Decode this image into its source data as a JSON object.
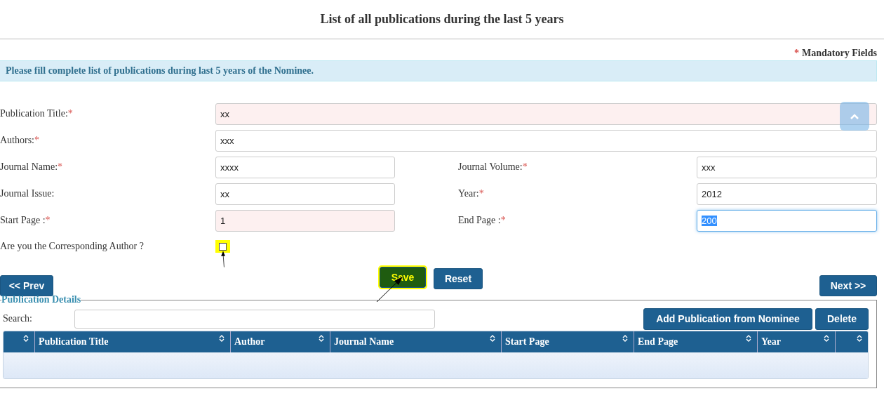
{
  "page_title": "List of all publications during the last 5 years",
  "mandatory_note": {
    "mark": "*",
    "text": "Mandatory Fields"
  },
  "info_message": "Please fill complete list of publications during last 5 years of the Nominee.",
  "form_rows": [
    {
      "kind": "full",
      "fields": [
        {
          "label": "Publication Title:",
          "mark": "*",
          "value": "xx",
          "invalid": true,
          "focused": false,
          "selected_text": false
        }
      ]
    },
    {
      "kind": "full",
      "fields": [
        {
          "label": "Authors:",
          "mark": "*",
          "value": "xxx",
          "invalid": false,
          "focused": false,
          "selected_text": false
        }
      ]
    },
    {
      "kind": "pair",
      "fields": [
        {
          "label": "Journal Name:",
          "mark": "*",
          "value": "xxxx",
          "invalid": false,
          "focused": false,
          "selected_text": false
        },
        {
          "label": "Journal Volume:",
          "mark": "*",
          "value": "xxx",
          "invalid": false,
          "focused": false,
          "selected_text": false
        }
      ]
    },
    {
      "kind": "pair",
      "fields": [
        {
          "label": "Journal Issue:",
          "value": "xx",
          "invalid": false,
          "focused": false,
          "selected_text": false
        },
        {
          "label": "Year:",
          "mark": "*",
          "value": "2012",
          "invalid": false,
          "focused": false,
          "selected_text": false
        }
      ]
    },
    {
      "kind": "pair",
      "fields": [
        {
          "label": "Start Page :",
          "mark": "*",
          "value": "1",
          "invalid": true,
          "focused": false,
          "selected_text": false
        },
        {
          "label": "End Page :",
          "mark": "*",
          "value": "200",
          "invalid": false,
          "focused": true,
          "selected_text": true
        }
      ]
    }
  ],
  "corresponding_author": {
    "label": "Are you the Corresponding Author ?",
    "checked": false,
    "highlighted": true
  },
  "buttons": {
    "prev": "<< Prev",
    "save": {
      "label": "Save",
      "highlighted": true
    },
    "reset": "Reset",
    "next": "Next >>"
  },
  "publication_details": {
    "legend": "Publication Details",
    "search_label": "Search:",
    "actions": [
      "Add Publication from Nominee",
      "Delete"
    ],
    "table": {
      "columns": [
        "",
        "Publication Title",
        "Author",
        "Journal Name",
        "Start Page",
        "End Page",
        "Year",
        ""
      ]
    }
  }
}
